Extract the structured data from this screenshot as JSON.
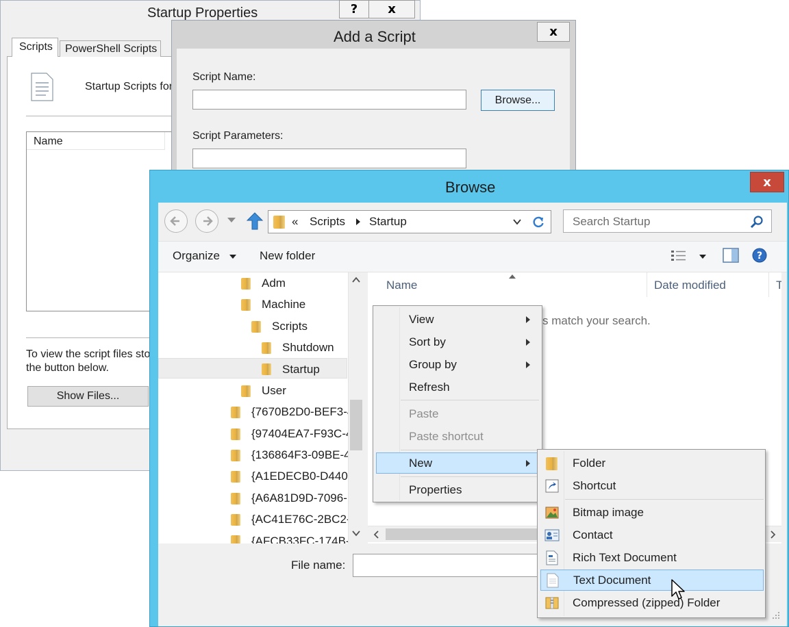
{
  "startup_dialog": {
    "title": "Startup Properties",
    "help_label": "?",
    "close_label": "x",
    "tabs": [
      {
        "label": "Scripts"
      },
      {
        "label": "PowerShell Scripts"
      }
    ],
    "description": "Startup Scripts for",
    "column_name": "Name",
    "bottom_text_line1": "To view the script files sto",
    "bottom_text_line2": "the button below.",
    "show_files_label": "Show Files..."
  },
  "add_script_dialog": {
    "title": "Add a Script",
    "close_label": "x",
    "script_name_label": "Script Name:",
    "script_name_value": "",
    "browse_label": "Browse...",
    "script_params_label": "Script Parameters:",
    "script_params_value": ""
  },
  "browse_dialog": {
    "title": "Browse",
    "close_label": "x",
    "breadcrumb": {
      "overflow": "«",
      "parts": [
        "Scripts",
        "Startup"
      ]
    },
    "search_placeholder": "Search Startup",
    "toolbar": {
      "organize": "Organize",
      "new_folder": "New folder"
    },
    "tree": [
      {
        "label": "Adm"
      },
      {
        "label": "Machine"
      },
      {
        "label": "Scripts"
      },
      {
        "label": "Shutdown"
      },
      {
        "label": "Startup",
        "selected": true
      },
      {
        "label": "User"
      },
      {
        "label": "{7670B2D0-BEF3-4"
      },
      {
        "label": "{97404EA7-F93C-4"
      },
      {
        "label": "{136864F3-09BE-4"
      },
      {
        "label": "{A1EDECB0-D440-"
      },
      {
        "label": "{A6A81D9D-7096-"
      },
      {
        "label": "{AC41E76C-2BC2-"
      },
      {
        "label": "{AFCB33FC-174B-"
      }
    ],
    "columns": {
      "name": "Name",
      "date_modified": "Date modified",
      "type": "T"
    },
    "empty_text": "s match your search.",
    "file_name_label": "File name:",
    "file_name_value": ""
  },
  "context_menu": {
    "items": [
      {
        "label": "View",
        "submenu": true
      },
      {
        "label": "Sort by",
        "submenu": true
      },
      {
        "label": "Group by",
        "submenu": true
      },
      {
        "label": "Refresh"
      },
      {
        "label": "Paste",
        "disabled": true
      },
      {
        "label": "Paste shortcut",
        "disabled": true
      },
      {
        "label": "New",
        "submenu": true,
        "highlighted": true
      },
      {
        "label": "Properties"
      }
    ]
  },
  "new_submenu": {
    "items": [
      {
        "label": "Folder",
        "icon": "folder-icon"
      },
      {
        "label": "Shortcut",
        "icon": "shortcut-icon"
      },
      {
        "label": "Bitmap image",
        "icon": "bitmap-icon"
      },
      {
        "label": "Contact",
        "icon": "contact-icon"
      },
      {
        "label": "Rich Text Document",
        "icon": "rich-text-icon"
      },
      {
        "label": "Text Document",
        "icon": "text-document-icon",
        "highlighted": true
      },
      {
        "label": "Compressed (zipped) Folder",
        "icon": "zip-folder-icon"
      }
    ]
  },
  "colors": {
    "accent": "#5bc6ec",
    "close_red": "#c7493a",
    "highlight": "#cce8ff"
  }
}
